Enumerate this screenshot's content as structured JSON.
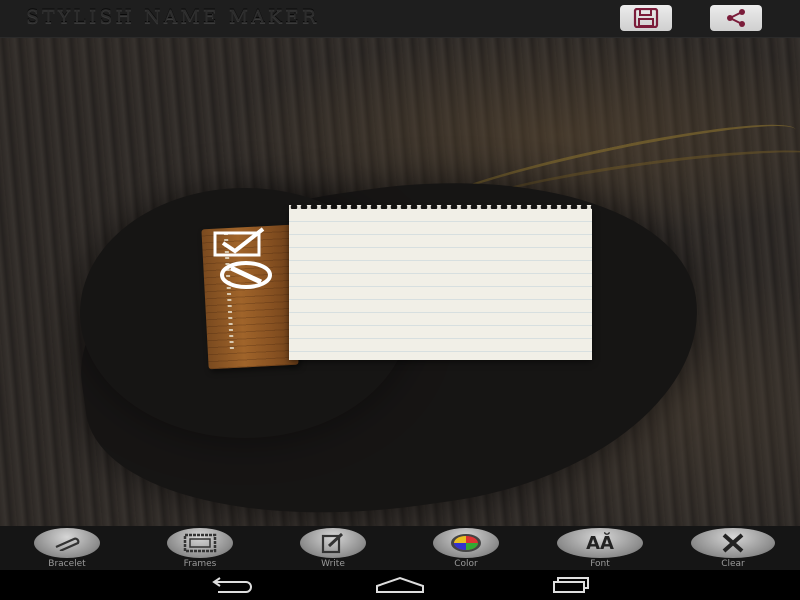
{
  "app": {
    "title": "STYLISH NAME MAKER"
  },
  "toolbar": [
    {
      "label": "Bracelet",
      "icon": "bracelet-icon"
    },
    {
      "label": "Frames",
      "icon": "frame-icon"
    },
    {
      "label": "Write",
      "icon": "edit-icon"
    },
    {
      "label": "Color",
      "icon": "color-wheel-icon"
    },
    {
      "label": "Font",
      "icon": "font-icon",
      "glyph": "AĂ"
    },
    {
      "label": "Clear",
      "icon": "close-icon"
    }
  ],
  "topbar": {
    "save_icon": "save-icon",
    "share_icon": "share-icon"
  },
  "colors": {
    "accent": "#7b1c3a",
    "wood": "#a0642a",
    "paper": "#f1efe7"
  }
}
